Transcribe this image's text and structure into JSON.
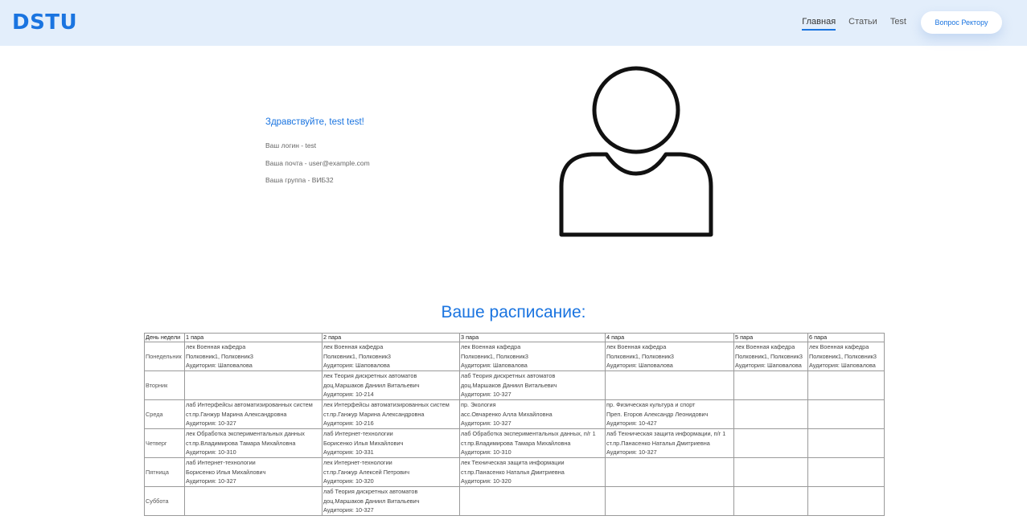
{
  "header": {
    "logo": "DSTU",
    "nav": [
      "Главная",
      "Статьи",
      "Test"
    ],
    "cta": "Вопрос Ректору"
  },
  "profile": {
    "greeting": "Здравствуйте, test test!",
    "login": "Ваш логин - test",
    "email": "Ваша почта - user@example.com",
    "group": "Ваша группа - ВИБ32"
  },
  "schedule": {
    "title": "Ваше расписание:",
    "headers": [
      "День недели",
      "1 пара",
      "2 пара",
      "3 пара",
      "4 пара",
      "5 пара",
      "6 пара"
    ],
    "rows": [
      {
        "day": "Понедельник",
        "cells": [
          [
            "лек Военная кафедра",
            "Полковник1, Полковник3",
            "Аудитория: Шаповалова"
          ],
          [
            "лек Военная кафедра",
            "Полковник1, Полковник3",
            "Аудитория: Шаповалова"
          ],
          [
            "лек Военная кафедра",
            "Полковник1, Полковник3",
            "Аудитория: Шаповалова"
          ],
          [
            "лек Военная кафедра",
            "Полковник1, Полковник3",
            "Аудитория: Шаповалова"
          ],
          [
            "лек Военная кафедра",
            "Полковник1, Полковник3",
            "Аудитория: Шаповалова"
          ],
          [
            "лек Военная кафедра",
            "Полковник1, Полковник3",
            "Аудитория: Шаповалова"
          ]
        ]
      },
      {
        "day": "Вторник",
        "cells": [
          [],
          [
            "лек Теория дискретных автоматов",
            "доц.Маршаков Даниил Витальевич",
            "Аудитория: 10-214"
          ],
          [
            "лаб Теория дискретных автоматов",
            "доц.Маршаков Даниил Витальевич",
            "Аудитория: 10-327"
          ],
          [],
          [],
          []
        ]
      },
      {
        "day": "Среда",
        "cells": [
          [
            "лаб Интерфейсы автоматизированных систем",
            "ст.пр.Ганжур Марина Александровна",
            "Аудитория: 10-327"
          ],
          [
            "лек Интерфейсы автоматизированных систем",
            "ст.пр.Ганжур Марина Александровна",
            "Аудитория: 10-216"
          ],
          [
            "пр. Экология",
            "асс.Овчаренко Алла Михайловна",
            "Аудитория: 10-327"
          ],
          [
            "пр. Физическая культура и спорт",
            "Преп. Егоров Александр Леонидович",
            "Аудитория: 10-427"
          ],
          [],
          []
        ]
      },
      {
        "day": "Четверг",
        "cells": [
          [
            "лек Обработка экспериментальных данных",
            "ст.пр.Владимирова Тамара Михайловна",
            "Аудитория: 10-310"
          ],
          [
            "лаб Интернет-технологии",
            "Борисенко Илья Михайлович",
            "Аудитория: 10-331"
          ],
          [
            "лаб Обработка экспериментальных данных, п/г 1",
            "ст.пр.Владимирова Тамара Михайловна",
            "Аудитория: 10-310"
          ],
          [
            "лаб Техническая защита информации, п/г 1",
            "ст.пр.Панасенко Наталья Дмитриевна",
            "Аудитория: 10-327"
          ],
          [],
          []
        ]
      },
      {
        "day": "Пятница",
        "cells": [
          [
            "лаб Интернет-технологии",
            "Борисенко Илья Михайлович",
            "Аудитория: 10-327"
          ],
          [
            "лек Интернет-технологии",
            "ст.пр.Ганжур Алексей Петрович",
            "Аудитория: 10-320"
          ],
          [
            "лек Техническая защита информации",
            "ст.пр.Панасенко Наталья Дмитриевна",
            "Аудитория: 10-320"
          ],
          [],
          [],
          []
        ]
      },
      {
        "day": "Суббота",
        "cells": [
          [],
          [
            "лаб Теория дискретных автоматов",
            "доц.Маршаков Даниил Витальевич",
            "Аудитория: 10-327"
          ],
          [],
          [],
          [],
          []
        ]
      }
    ]
  },
  "colors": {
    "accent": "#1a74e0",
    "header_bg": "#e3eefb"
  },
  "icons": {
    "avatar": "user-silhouette-icon"
  }
}
